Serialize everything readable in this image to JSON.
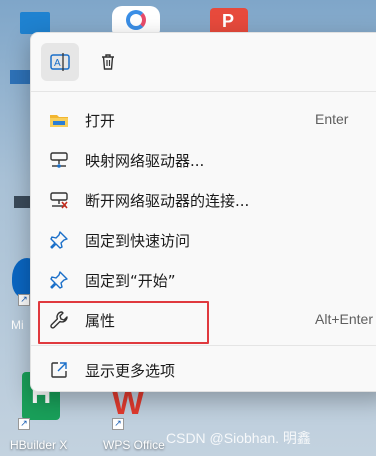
{
  "desktop": {
    "top_icon_3_letter": "P",
    "left_label_fragment": "Mi",
    "bottom_icons": [
      {
        "label": "HBuilder X",
        "glyph": "H",
        "color": "#19a05a"
      },
      {
        "label": "WPS Office",
        "glyph": "W",
        "color": "#e23a2e"
      }
    ],
    "watermark": "CSDN @Siobhan. 明鑫"
  },
  "context_menu": {
    "toolbar": [
      {
        "name": "rename",
        "icon": "rename-icon"
      },
      {
        "name": "delete",
        "icon": "trash-icon"
      }
    ],
    "items": [
      {
        "label": "打开",
        "shortcut": "Enter",
        "icon": "folder-icon"
      },
      {
        "label": "映射网络驱动器...",
        "shortcut": "",
        "icon": "network-drive-icon"
      },
      {
        "label": "断开网络驱动器的连接...",
        "shortcut": "",
        "icon": "disconnect-drive-icon"
      },
      {
        "label": "固定到快速访问",
        "shortcut": "",
        "icon": "pin-icon"
      },
      {
        "label": "固定到“开始”",
        "shortcut": "",
        "icon": "pin-icon"
      },
      {
        "label": "属性",
        "shortcut": "Alt+Enter",
        "icon": "wrench-icon"
      },
      {
        "label": "显示更多选项",
        "shortcut": "",
        "icon": "open-external-icon"
      }
    ],
    "highlighted_item": "属性",
    "colors": {
      "accent": "#1a6fc9",
      "highlight": "#e0393e"
    }
  }
}
